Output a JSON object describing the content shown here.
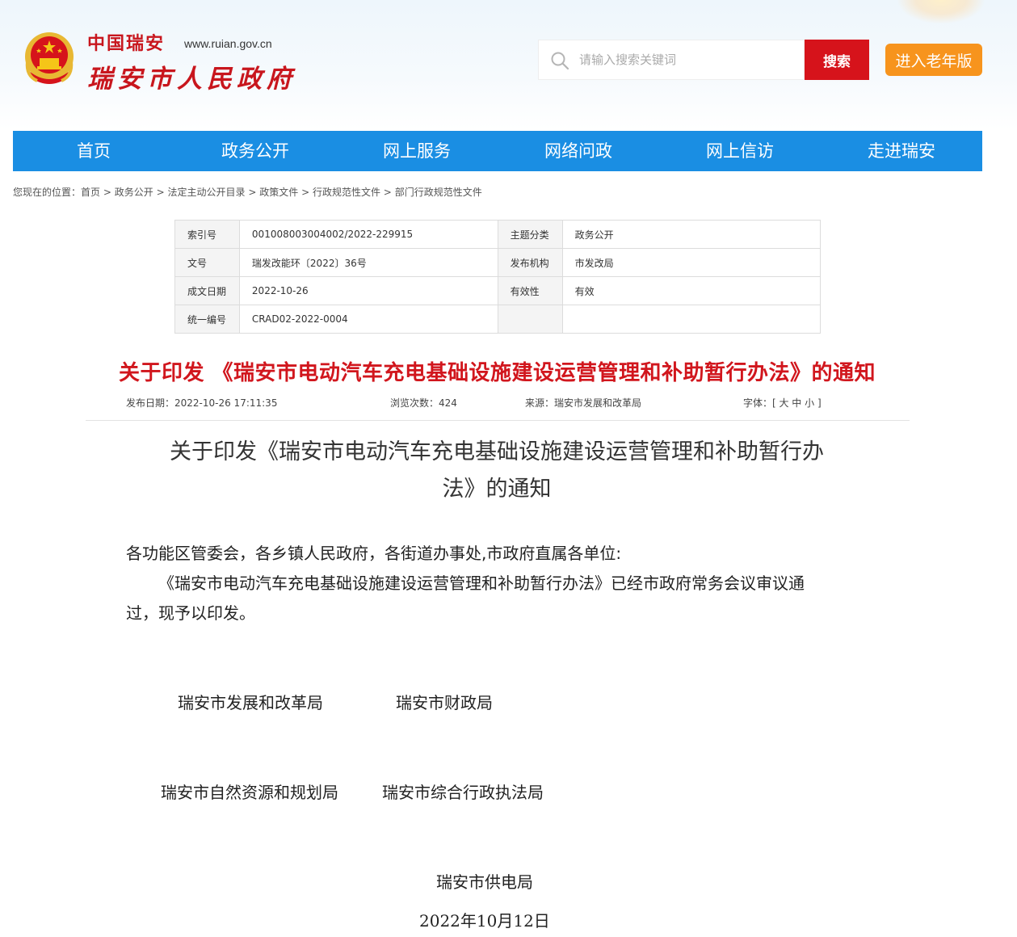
{
  "header": {
    "logo_top": "中国瑞安",
    "logo_url": "www.ruian.gov.cn",
    "logo_main": "瑞安市人民政府",
    "search_placeholder": "请输入搜索关键词",
    "search_button": "搜索",
    "elder_button": "进入老年版",
    "colors": {
      "brand_red": "#d6131b",
      "nav_blue": "#1a8ee3",
      "elder_orange": "#f7941d"
    }
  },
  "nav": {
    "items": [
      "首页",
      "政务公开",
      "网上服务",
      "网络问政",
      "网上信访",
      "走进瑞安"
    ]
  },
  "breadcrumb": {
    "prefix": "您现在的位置：",
    "items": [
      "首页",
      "政务公开",
      "法定主动公开目录",
      "政策文件",
      "行政规范性文件",
      "部门行政规范性文件"
    ],
    "separator": ">"
  },
  "meta": {
    "index_label": "索引号",
    "index_value": "001008003004002/2022-229915",
    "topic_label": "主题分类",
    "topic_value": "政务公开",
    "docno_label": "文号",
    "docno_value": "瑞发改能环〔2022〕36号",
    "issuer_label": "发布机构",
    "issuer_value": "市发改局",
    "date_label": "成文日期",
    "date_value": "2022-10-26",
    "valid_label": "有效性",
    "valid_value": "有效",
    "code_label": "统一编号",
    "code_value": "CRAD02-2022-0004"
  },
  "article": {
    "title": "关于印发 《瑞安市电动汽车充电基础设施建设运营管理和补助暂行办法》的通知",
    "publish_date": "发布日期：2022-10-26 17:11:35",
    "views": "浏览次数：424",
    "source": "来源：瑞安市发展和改革局",
    "font_size": "字体：[ 大 中 小 ]",
    "doc_title_line1": "关于印发《瑞安市电动汽车充电基础设施建设运营管理和补助暂行办",
    "doc_title_line2": "法》的通知",
    "salutation": "各功能区管委会，各乡镇人民政府，各街道办事处,市政府直属各单位:",
    "body_line1": "《瑞安市电动汽车充电基础设施建设运营管理和补助暂行办法》已经市政府常务会议审议通",
    "body_line2": "过，现予以印发。",
    "signers": [
      "瑞安市发展和改革局",
      "瑞安市财政局",
      "瑞安市自然资源和规划局",
      "瑞安市综合行政执法局",
      "瑞安市供电局"
    ],
    "sign_date": "2022年10月12日"
  }
}
